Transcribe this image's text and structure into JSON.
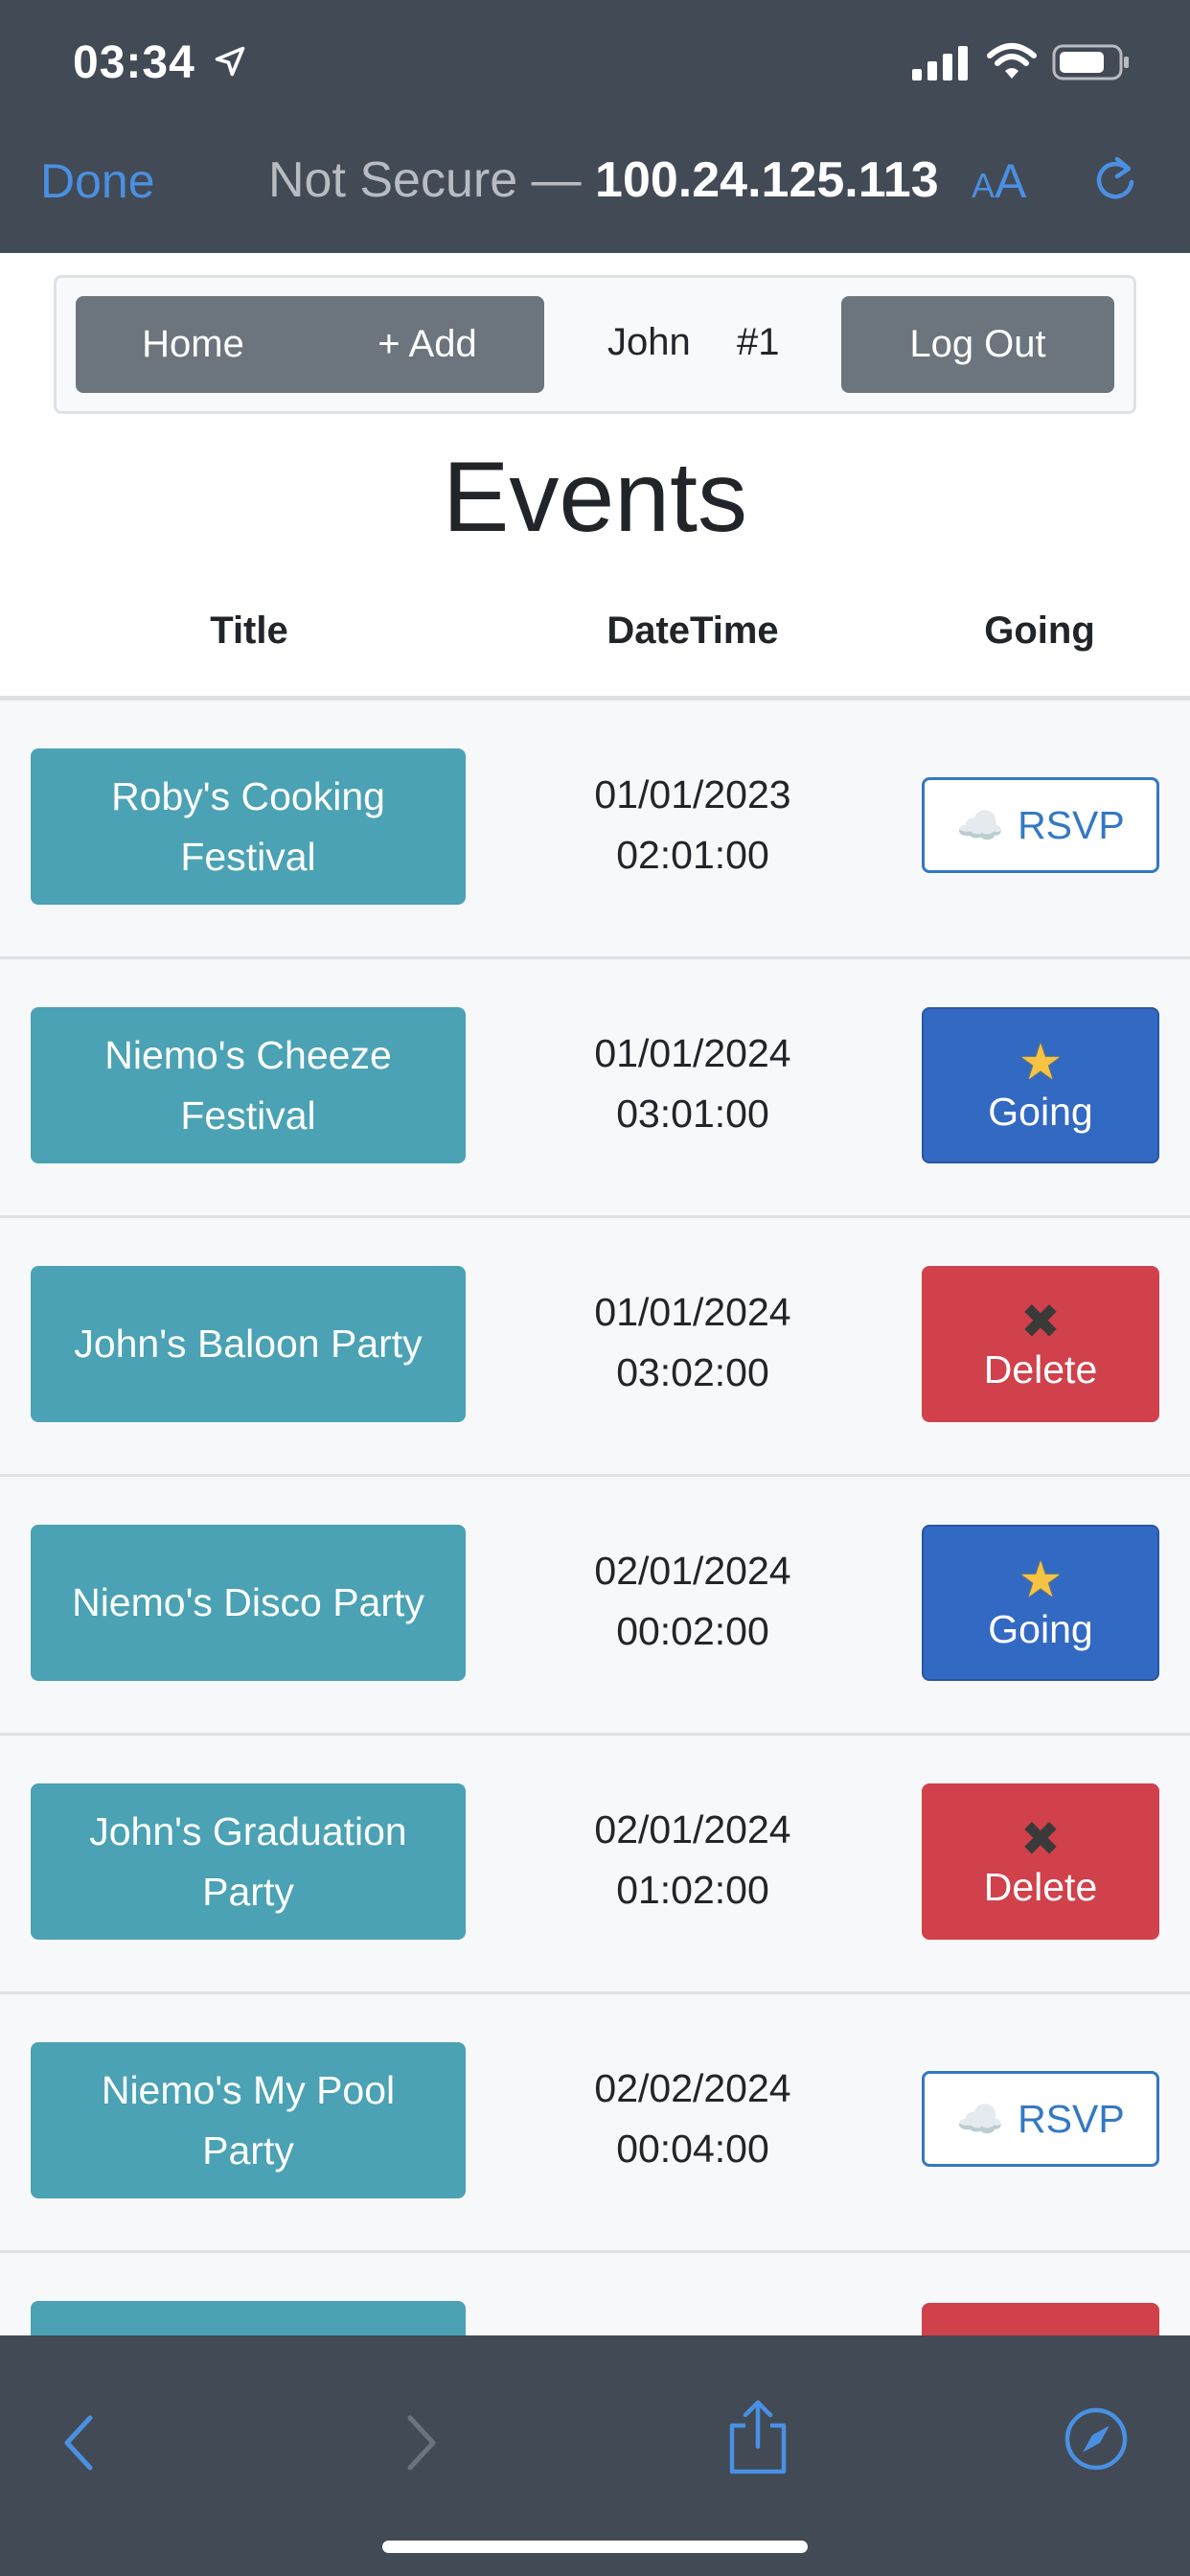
{
  "status_bar": {
    "time": "03:34"
  },
  "browser": {
    "done_label": "Done",
    "security_label": "Not Secure —",
    "host": "100.24.125.113",
    "reader_label_small": "A",
    "reader_label_big": "A"
  },
  "nav": {
    "home_label": "Home",
    "add_label": "+ Add",
    "user_name": "John",
    "user_id": "#1",
    "logout_label": "Log Out"
  },
  "page": {
    "title": "Events"
  },
  "table": {
    "headers": {
      "title": "Title",
      "datetime": "DateTime",
      "going": "Going"
    },
    "rows": [
      {
        "title": "Roby's Cooking Festival",
        "date": "01/01/2023",
        "time": "02:01:00",
        "action": "RSVP"
      },
      {
        "title": "Niemo's Cheeze Festival",
        "date": "01/01/2024",
        "time": "03:01:00",
        "action": "Going"
      },
      {
        "title": "John's Baloon Party",
        "date": "01/01/2024",
        "time": "03:02:00",
        "action": "Delete"
      },
      {
        "title": "Niemo's Disco Party",
        "date": "02/01/2024",
        "time": "00:02:00",
        "action": "Going"
      },
      {
        "title": "John's Graduation Party",
        "date": "02/01/2024",
        "time": "01:02:00",
        "action": "Delete"
      },
      {
        "title": "Niemo's My Pool Party",
        "date": "02/02/2024",
        "time": "00:04:00",
        "action": "RSVP"
      },
      {
        "title": "",
        "date": "",
        "time": "",
        "action": ""
      }
    ]
  },
  "icons": {
    "rsvp": "cloud-icon",
    "going": "star-icon",
    "delete": "x-icon"
  },
  "colors": {
    "accent": "#4a90e2",
    "title_button": "#4aa2b4",
    "going_button": "#3269c2",
    "delete_button": "#d0414b",
    "secondary_button": "#6c757d",
    "chrome": "#424a55"
  }
}
